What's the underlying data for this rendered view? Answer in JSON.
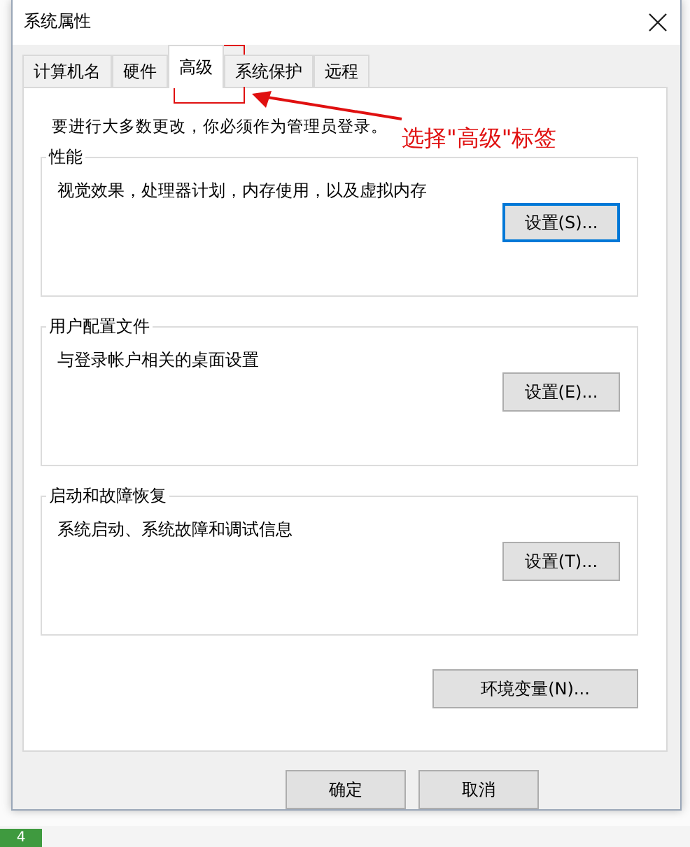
{
  "window": {
    "title": "系统属性"
  },
  "tabs": [
    {
      "label": "计算机名",
      "selected": false
    },
    {
      "label": "硬件",
      "selected": false
    },
    {
      "label": "高级",
      "selected": true
    },
    {
      "label": "系统保护",
      "selected": false
    },
    {
      "label": "远程",
      "selected": false
    }
  ],
  "notice": "要进行大多数更改，你必须作为管理员登录。",
  "annotation": {
    "label": "选择\"高级\"标签"
  },
  "groups": [
    {
      "title": "性能",
      "description": "视觉效果，处理器计划，内存使用，以及虚拟内存",
      "button": {
        "label": "设置(S)...",
        "focused": true
      }
    },
    {
      "title": "用户配置文件",
      "description": "与登录帐户相关的桌面设置",
      "button": {
        "label": "设置(E)...",
        "focused": false
      }
    },
    {
      "title": "启动和故障恢复",
      "description": "系统启动、系统故障和调试信息",
      "button": {
        "label": "设置(T)...",
        "focused": false
      }
    }
  ],
  "env_button": "环境变量(N)...",
  "footer_buttons": [
    "确定",
    "取消"
  ],
  "background": {
    "step_number": "4"
  }
}
